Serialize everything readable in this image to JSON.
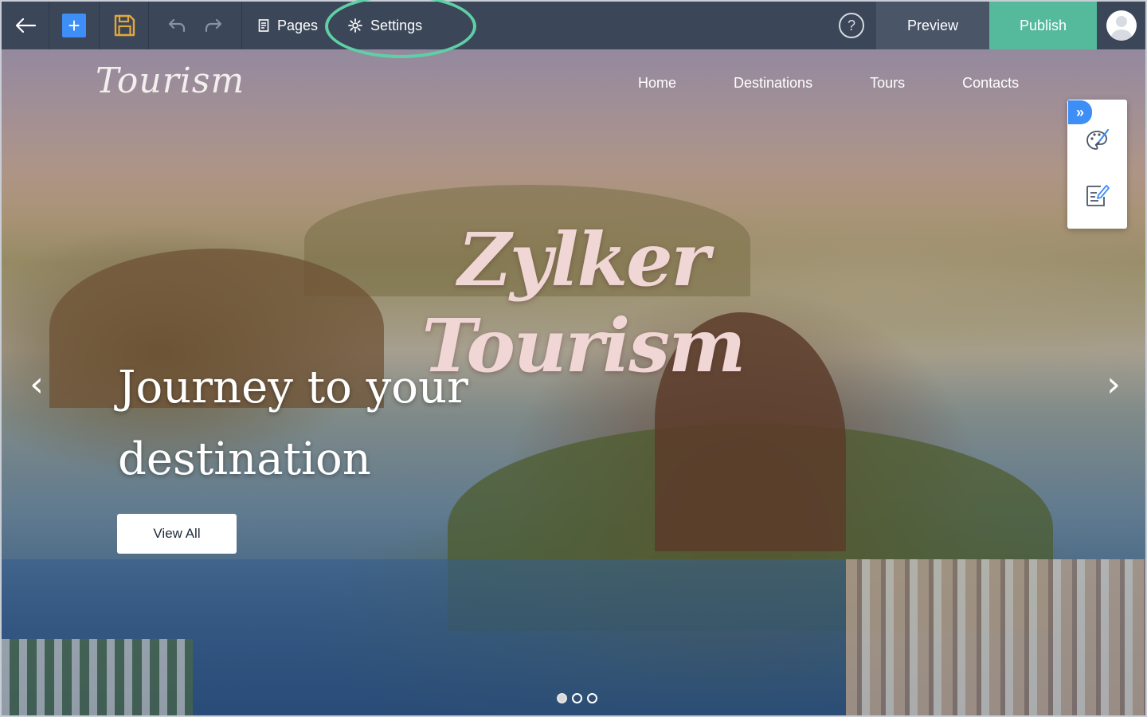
{
  "toolbar": {
    "pages_label": "Pages",
    "settings_label": "Settings",
    "help_label": "?",
    "preview_label": "Preview",
    "publish_label": "Publish",
    "add_symbol": "+"
  },
  "site": {
    "logo_text": "Tourism",
    "nav": {
      "home": "Home",
      "destinations": "Destinations",
      "tours": "Tours",
      "contacts": "Contacts"
    },
    "brand_title": "Zylker Tourism",
    "heading_line1": "Journey to your",
    "heading_line2": "destination",
    "cta_label": "View All",
    "prev_arrow": "‹",
    "next_arrow": "›",
    "slide_count": 3,
    "active_slide": 1
  },
  "side_panel": {
    "collapse_symbol": "»"
  },
  "colors": {
    "toolbar_bg": "#3b4658",
    "publish_bg": "#55b99b",
    "preview_bg": "#4a5568",
    "accent_blue": "#3e8ef7",
    "highlight_ring": "#5fcfa6",
    "brand_pink": "#f0d6d4"
  },
  "icons": {
    "back": "arrow-left-icon",
    "add": "plus-icon",
    "save": "floppy-disk-icon",
    "undo": "undo-icon",
    "redo": "redo-icon",
    "pages": "page-icon",
    "settings": "gear-icon",
    "help": "question-icon",
    "avatar": "user-avatar",
    "design": "palette-brush-icon",
    "content": "edit-document-icon"
  }
}
